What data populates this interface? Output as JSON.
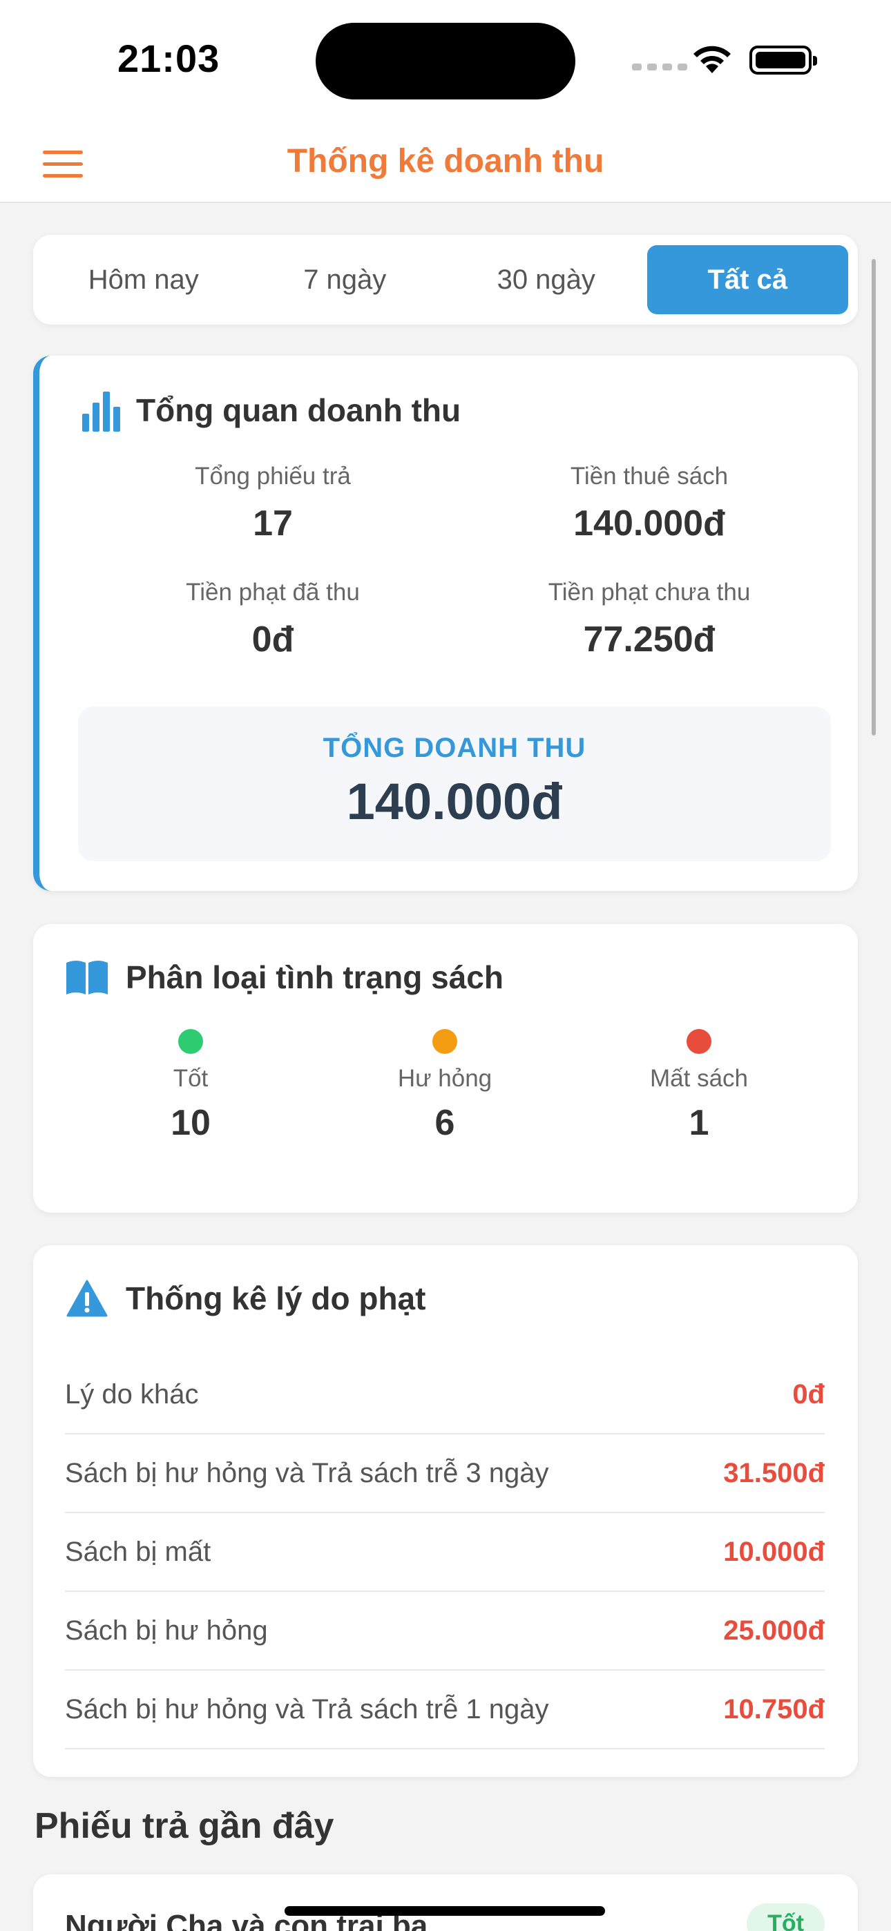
{
  "status_bar": {
    "time": "21:03"
  },
  "header": {
    "title": "Thống kê doanh thu"
  },
  "filter_tabs": [
    {
      "label": "Hôm nay",
      "active": false
    },
    {
      "label": "7 ngày",
      "active": false
    },
    {
      "label": "30 ngày",
      "active": false
    },
    {
      "label": "Tất cả",
      "active": true
    }
  ],
  "overview": {
    "title": "Tổng quan doanh thu",
    "stats": [
      {
        "label": "Tổng phiếu trả",
        "value": "17"
      },
      {
        "label": "Tiền thuê sách",
        "value": "140.000đ"
      },
      {
        "label": "Tiền phạt đã thu",
        "value": "0đ"
      },
      {
        "label": "Tiền phạt chưa thu",
        "value": "77.250đ"
      }
    ],
    "total_label": "TỔNG DOANH THU",
    "total_value": "140.000đ"
  },
  "condition": {
    "title": "Phân loại tình trạng sách",
    "items": [
      {
        "label": "Tốt",
        "value": "10",
        "color": "#2ecc71"
      },
      {
        "label": "Hư hỏng",
        "value": "6",
        "color": "#f39c12"
      },
      {
        "label": "Mất sách",
        "value": "1",
        "color": "#e74c3c"
      }
    ]
  },
  "penalty": {
    "title": "Thống kê lý do phạt",
    "rows": [
      {
        "reason": "Lý do khác",
        "amount": "0đ"
      },
      {
        "reason": "Sách bị hư hỏng và Trả sách trễ 3 ngày",
        "amount": "31.500đ"
      },
      {
        "reason": "Sách bị mất",
        "amount": "10.000đ"
      },
      {
        "reason": "Sách bị hư hỏng",
        "amount": "25.000đ"
      },
      {
        "reason": "Sách bị hư hỏng và Trả sách trễ 1 ngày",
        "amount": "10.750đ"
      }
    ]
  },
  "recent": {
    "title": "Phiếu trả gần đây",
    "first_item": {
      "name": "Người Cha và con trai ba",
      "badge": "Tốt"
    }
  },
  "colors": {
    "accent_orange": "#f07a3a",
    "accent_blue": "#3498db",
    "danger_red": "#e74c3c"
  },
  "icons": [
    "menu-icon",
    "bar-chart-icon",
    "open-book-icon",
    "warning-icon",
    "wifi-icon",
    "battery-icon"
  ]
}
